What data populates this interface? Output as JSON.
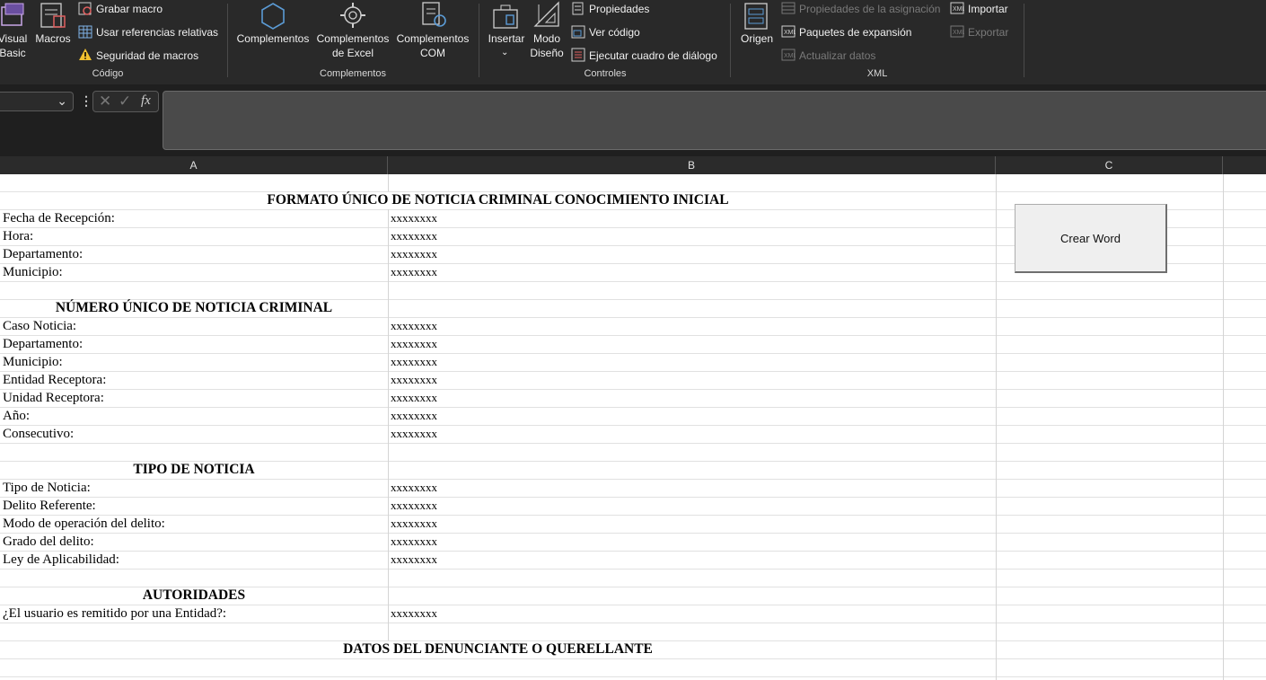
{
  "ribbon": {
    "visual_basic": "Visual\nBasic",
    "macros": "Macros",
    "grabar_macro": "Grabar macro",
    "usar_referencias": "Usar referencias relativas",
    "seguridad_macros": "Seguridad de macros",
    "grp_codigo": "Código",
    "complementos": "Complementos",
    "complementos_excel": "Complementos\nde Excel",
    "complementos_com": "Complementos\nCOM",
    "grp_complementos": "Complementos",
    "insertar": "Insertar",
    "modo_diseno": "Modo\nDiseño",
    "propiedades": "Propiedades",
    "ver_codigo": "Ver código",
    "ejecutar_cuadro": "Ejecutar cuadro de diálogo",
    "grp_controles": "Controles",
    "origen": "Origen",
    "propiedades_asignacion": "Propiedades de la asignación",
    "paquetes_expansion": "Paquetes de expansión",
    "actualizar_datos": "Actualizar datos",
    "importar": "Importar",
    "exportar": "Exportar",
    "grp_xml": "XML"
  },
  "formula_bar": {
    "name_box": "",
    "fx": "fx",
    "formula": ""
  },
  "columns": [
    "A",
    "B",
    "C"
  ],
  "button_crear_word": "Crear Word",
  "rows": [
    {
      "type": "header",
      "text": "FORMATO ÚNICO DE NOTICIA CRIMINAL CONOCIMIENTO INICIAL",
      "span": "AB"
    },
    {
      "type": "field",
      "label": "Fecha de Recepción:",
      "value": "xxxxxxxx"
    },
    {
      "type": "field",
      "label": "Hora:",
      "value": "xxxxxxxx"
    },
    {
      "type": "field",
      "label": "Departamento:",
      "value": "xxxxxxxx"
    },
    {
      "type": "field",
      "label": "Municipio:",
      "value": "xxxxxxxx"
    },
    {
      "type": "blank"
    },
    {
      "type": "header",
      "text": "NÚMERO ÚNICO DE NOTICIA CRIMINAL",
      "span": "A"
    },
    {
      "type": "field",
      "label": "Caso Noticia:",
      "value": "xxxxxxxx"
    },
    {
      "type": "field",
      "label": "Departamento:",
      "value": "xxxxxxxx"
    },
    {
      "type": "field",
      "label": "Municipio:",
      "value": "xxxxxxxx"
    },
    {
      "type": "field",
      "label": "Entidad Receptora:",
      "value": "xxxxxxxx"
    },
    {
      "type": "field",
      "label": "Unidad Receptora:",
      "value": "xxxxxxxx"
    },
    {
      "type": "field",
      "label": "Año:",
      "value": "xxxxxxxx"
    },
    {
      "type": "field",
      "label": "Consecutivo:",
      "value": "xxxxxxxx"
    },
    {
      "type": "blank"
    },
    {
      "type": "header",
      "text": "TIPO DE NOTICIA",
      "span": "A"
    },
    {
      "type": "field",
      "label": "Tipo de Noticia:",
      "value": "xxxxxxxx"
    },
    {
      "type": "field",
      "label": "Delito Referente:",
      "value": "xxxxxxxx"
    },
    {
      "type": "field",
      "label": "Modo de operación del delito:",
      "value": "xxxxxxxx"
    },
    {
      "type": "field",
      "label": "Grado del delito:",
      "value": "xxxxxxxx"
    },
    {
      "type": "field",
      "label": "Ley de Aplicabilidad:",
      "value": "xxxxxxxx"
    },
    {
      "type": "blank"
    },
    {
      "type": "header",
      "text": "AUTORIDADES",
      "span": "A"
    },
    {
      "type": "field",
      "label": "¿El usuario es remitido por una Entidad?:",
      "value": "xxxxxxxx"
    },
    {
      "type": "blank"
    },
    {
      "type": "header",
      "text": "DATOS DEL DENUNCIANTE O QUERELLANTE",
      "span": "AB"
    }
  ]
}
